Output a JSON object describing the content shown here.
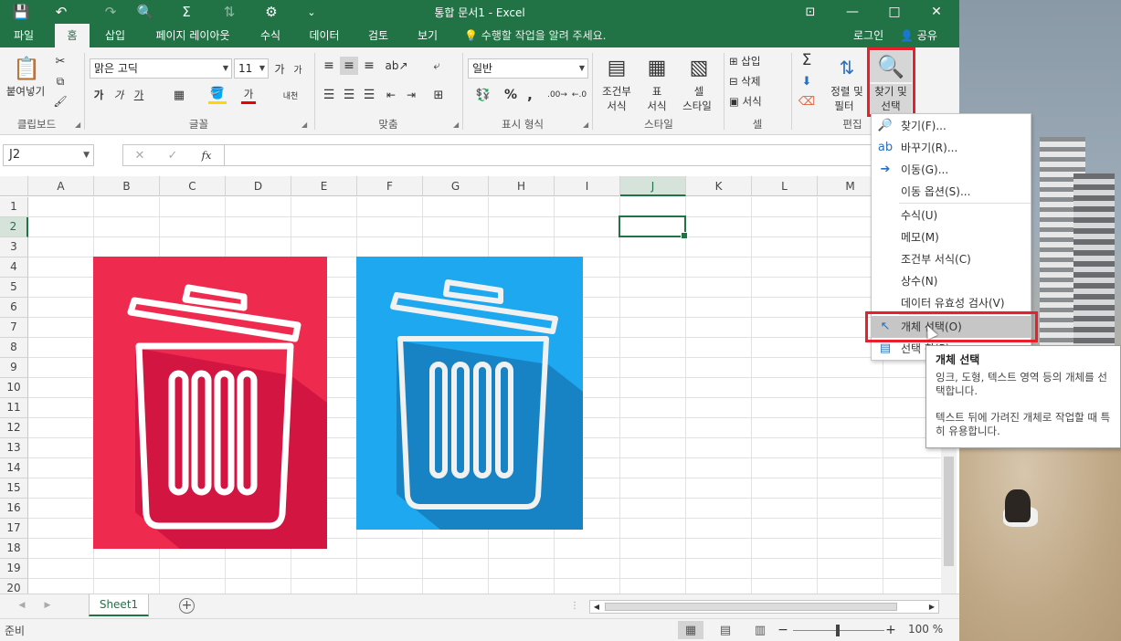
{
  "window": {
    "title": "통합 문서1 - Excel",
    "controls": {
      "restore": "⊡",
      "minimize": "—",
      "maximize": "□",
      "close": "✕"
    }
  },
  "quick_access": {
    "save_icon": "💾",
    "undo_icon": "↶",
    "redo_icon": "↷",
    "preview_icon": "🔍",
    "sum_icon": "Σ",
    "sort_icon": "⇅",
    "extra_icon": "⚙",
    "more_icon": "⌄"
  },
  "ribbon_tabs": [
    "파일",
    "홈",
    "삽입",
    "페이지 레이아웃",
    "수식",
    "데이터",
    "검토",
    "보기"
  ],
  "active_tab": "홈",
  "tell_me": "수행할 작업을 알려 주세요.",
  "account": {
    "login": "로그인",
    "share": "공유"
  },
  "ribbon": {
    "clipboard": {
      "paste": "붙여넣기",
      "group": "클립보드"
    },
    "font": {
      "name": "맑은 고딕",
      "size": "11",
      "bold": "가",
      "italic": "가",
      "underline": "가",
      "grow": "가",
      "shrink": "가",
      "phonetic": "내천",
      "font_color_letter": "가",
      "group": "글꼴"
    },
    "alignment": {
      "group": "맞춤"
    },
    "number": {
      "format": "일반",
      "percent": "%",
      "comma": ",",
      "group": "표시 형식"
    },
    "styles": {
      "conditional_1": "조건부",
      "conditional_2": "서식",
      "table_1": "표",
      "table_2": "서식",
      "cell_1": "셀",
      "cell_2": "스타일",
      "group": "스타일"
    },
    "cells": {
      "insert": "삽입",
      "delete": "삭제",
      "format": "서식",
      "group": "셀"
    },
    "editing": {
      "sort_1": "정렬 및",
      "sort_2": "필터",
      "find_1": "찾기 및",
      "find_2": "선택",
      "group": "편집"
    }
  },
  "formula_bar": {
    "name_box": "J2",
    "cancel": "✕",
    "enter": "✓",
    "fx": "fx",
    "value": ""
  },
  "sheet": {
    "columns": [
      "A",
      "B",
      "C",
      "D",
      "E",
      "F",
      "G",
      "H",
      "I",
      "J",
      "K",
      "L",
      "M"
    ],
    "rows": [
      "1",
      "2",
      "3",
      "4",
      "5",
      "6",
      "7",
      "8",
      "9",
      "10",
      "11",
      "12",
      "13",
      "14",
      "15",
      "16",
      "17",
      "18",
      "19",
      "20"
    ],
    "selected_column": "J",
    "selected_row": "2",
    "tab": "Sheet1",
    "add_sheet": "+"
  },
  "pictures": {
    "red": {
      "bg": "#ef2a4f",
      "shadow": "#d31542"
    },
    "blue": {
      "bg": "#1ea8f0",
      "shadow": "#1783c4"
    }
  },
  "status": {
    "ready": "준비",
    "zoom": "100 %",
    "minus": "−",
    "plus": "+"
  },
  "find_menu": {
    "items": [
      {
        "icon": "search-icon",
        "glyph": "🔎",
        "label": "찾기(F)..."
      },
      {
        "icon": "replace-icon",
        "glyph": "ab",
        "label": "바꾸기(R)..."
      },
      {
        "icon": "arrow-right-icon",
        "glyph": "➔",
        "label": "이동(G)..."
      },
      {
        "icon": "",
        "glyph": "",
        "label": "이동 옵션(S)..."
      },
      {
        "icon": "",
        "glyph": "",
        "label": "수식(U)"
      },
      {
        "icon": "",
        "glyph": "",
        "label": "메모(M)"
      },
      {
        "icon": "",
        "glyph": "",
        "label": "조건부 서식(C)"
      },
      {
        "icon": "",
        "glyph": "",
        "label": "상수(N)"
      },
      {
        "icon": "",
        "glyph": "",
        "label": "데이터 유효성 검사(V)"
      },
      {
        "icon": "pointer-icon",
        "glyph": "↖",
        "label": "개체 선택(O)"
      },
      {
        "icon": "selection-pane-icon",
        "glyph": "▤",
        "label": "선택 창(P)..."
      }
    ],
    "highlighted": "개체 선택(O)"
  },
  "tooltip": {
    "title": "개체 선택",
    "p1": "잉크, 도형, 텍스트 영역 등의 개체를 선택합니다.",
    "p2": "텍스트 뒤에 가려진 개체로 작업할 때 특히 유용합니다."
  },
  "colors": {
    "excel_green": "#217346",
    "highlight_red": "#e8202e"
  }
}
